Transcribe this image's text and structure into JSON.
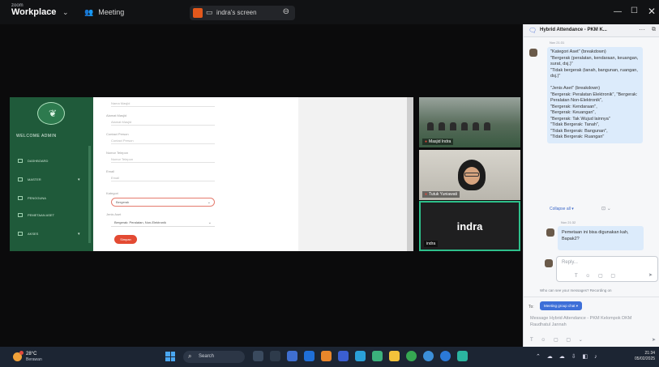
{
  "topbar": {
    "brand_small": "zoom",
    "brand_big": "Workplace",
    "meeting_label": "Meeting",
    "share_label": "indra's screen"
  },
  "shared_screen": {
    "sidebar": {
      "welcome": "WELCOME ADMIN",
      "items": [
        {
          "label": "DASHBOARD",
          "caret": ""
        },
        {
          "label": "MASTER",
          "caret": "▾"
        },
        {
          "label": "PENGGUNA",
          "caret": ""
        },
        {
          "label": "PEMETAAN ASET",
          "caret": ""
        },
        {
          "label": "AKSES",
          "caret": "▾"
        }
      ]
    },
    "form": {
      "fields": [
        {
          "label": "",
          "value": "Nama Masjid"
        },
        {
          "label": "Alamat Masjid",
          "value": "Alamat Masjid"
        },
        {
          "label": "Contact Person",
          "value": "Contact Person"
        },
        {
          "label": "Nomor Telepon",
          "value": "Nomor Telepon"
        },
        {
          "label": "Email",
          "value": "Email"
        }
      ],
      "kategori_label": "Kategori",
      "kategori_value": "Bergerak",
      "jenis_label": "Jenis Aset",
      "jenis_value": "Bergerak: Peralatan, Non-Elektronik",
      "save_label": "Simpan"
    }
  },
  "videos": [
    {
      "name": "Masjid Indra",
      "kind": "room"
    },
    {
      "name": "Tutuk Yuniawati",
      "kind": "person"
    },
    {
      "name": "indra",
      "avatar_text": "indra",
      "kind": "avatar"
    }
  ],
  "chat": {
    "title": "Hybrid Attendance - PKM K...",
    "time1": "Nov 21:31",
    "message1": "\"Kategori Aset\" (breakdown)\n\"Bergerak (peralatan, kendaraan, keuangan, surat, dsj.)\"\n\"Tidak bergerak (tanah, bangunan, ruangan, dsj.)\"\n\n\"Jenis Aset\" (breakdown)\n\"Bergerak: Peralatan Elektronik\", \"Bergerak: Peralatan Non-Elektronik\",\n\"Bergerak: Kendaraan\",\n\"Bergerak: Keuangan\",\n\"Bergerak: Tak Wujud lainnya\"\n\"Tidak Bergerak: Tanah\",\n\"Tidak Bergerak: Bangunan\",\n\"Tidak Bergerak: Ruangan\"",
    "collapse_label": "Collapse all ▾",
    "time2": "Nov 21:32",
    "message2": "Pemetaan ini bisa digunakan kah, Bapak2?",
    "reply_placeholder": "Reply...",
    "who_can_see": "Who can see your messages? Recording on",
    "to_label": "To:",
    "recipient": "Meeting group chat ▾",
    "message_placeholder": "Message Hybrid Attendance - PKM Kelompok DKM Raudhatul Jannah"
  },
  "taskbar": {
    "temp": "28°C",
    "weather": "Berawan",
    "search_label": "Search",
    "time": "21:34",
    "date": "05/02/2025"
  },
  "colors": {
    "sidebar_green": "#1f5a3a",
    "accent_red": "#e34a33",
    "zoom_blue": "#3d6fd8",
    "active_speaker": "#2ec08b"
  }
}
